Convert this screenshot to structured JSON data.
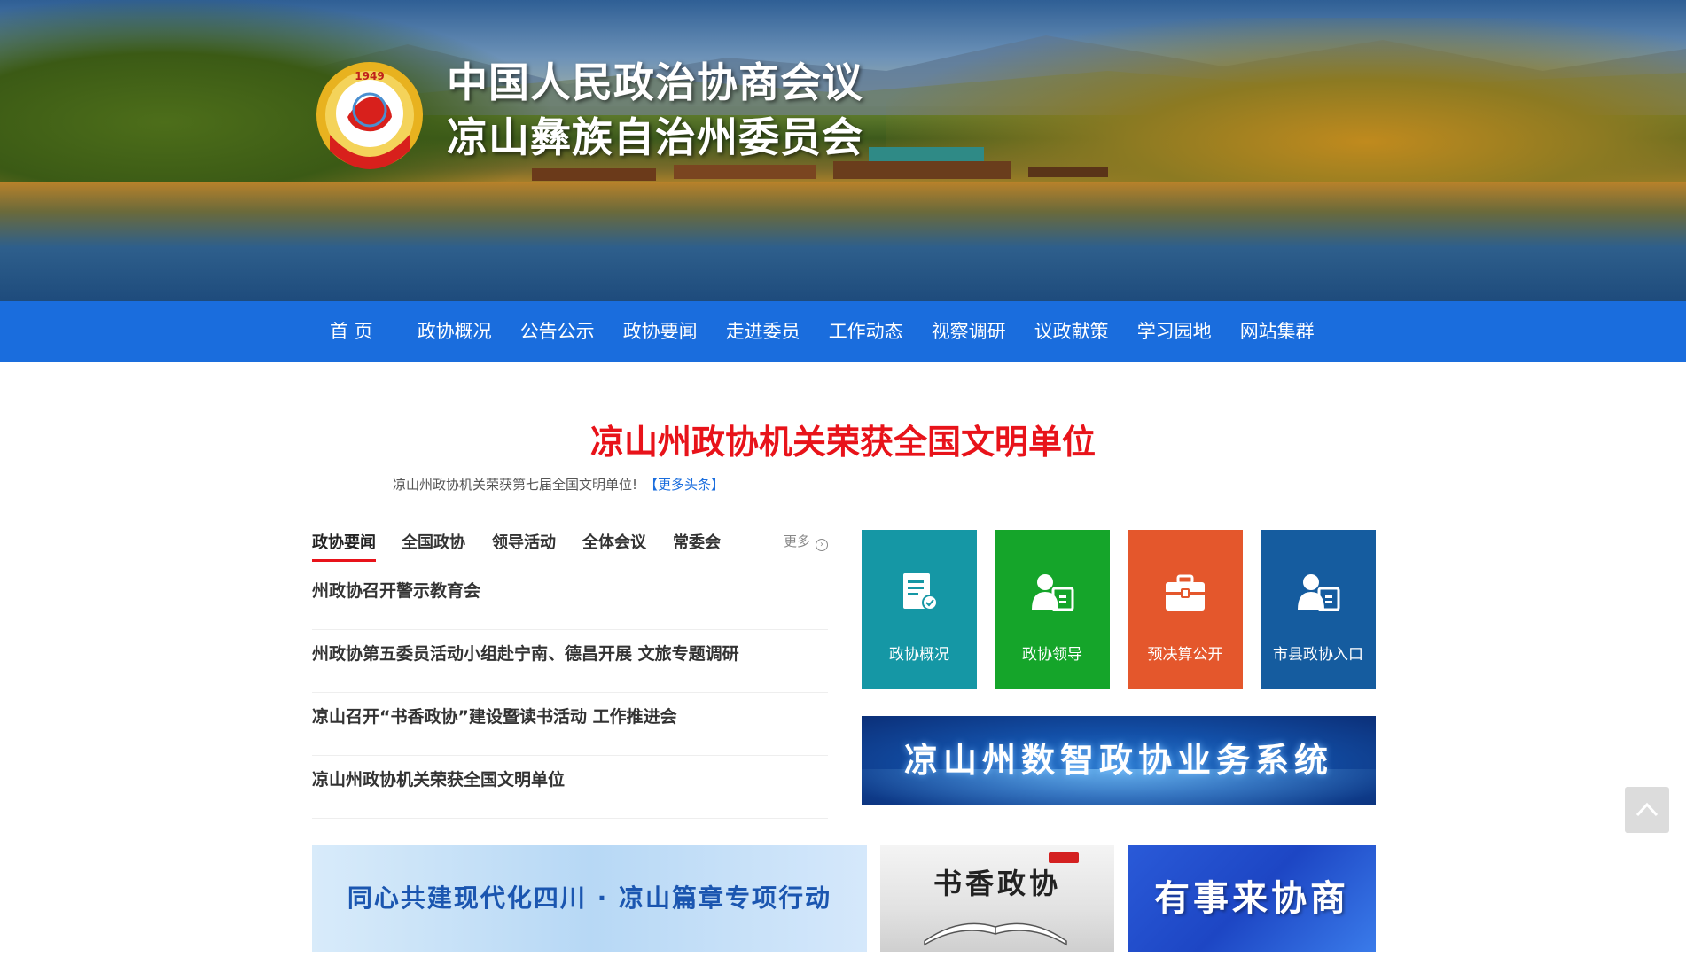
{
  "header": {
    "title_line1": "中国人民政治协商会议",
    "title_line2": "凉山彝族自治州委员会",
    "emblem_year": "1949"
  },
  "nav": {
    "items": [
      "首 页",
      "政协概况",
      "公告公示",
      "政协要闻",
      "走进委员",
      "工作动态",
      "视察调研",
      "议政献策",
      "学习园地",
      "网站集群"
    ]
  },
  "headline": {
    "title": "凉山州政协机关荣获全国文明单位",
    "summary": "凉山州政协机关荣获第七届全国文明单位!",
    "more_label": "【更多头条】"
  },
  "news": {
    "tabs": [
      "政协要闻",
      "全国政协",
      "领导活动",
      "全体会议",
      "常委会"
    ],
    "active_tab": "政协要闻",
    "more_label": "更多",
    "items": [
      "州政协召开警示教育会",
      "州政协第五委员活动小组赴宁南、德昌开展 文旅专题调研",
      "凉山召开“书香政协”建设暨读书活动 工作推进会",
      "凉山州政协机关荣获全国文明单位"
    ]
  },
  "tiles": [
    {
      "label": "政协概况",
      "icon": "document-icon",
      "color": "#1597a5"
    },
    {
      "label": "政协领导",
      "icon": "person-card-icon",
      "color": "#15a52a"
    },
    {
      "label": "预决算公开",
      "icon": "briefcase-icon",
      "color": "#e4572c"
    },
    {
      "label": "市县政协入口",
      "icon": "person-card-icon",
      "color": "#155c9f"
    }
  ],
  "system_banner": {
    "label": "凉山州数智政协业务系统"
  },
  "bottom_banners": {
    "b1": "同心共建现代化四川 · 凉山篇章专项行动",
    "b2": "书香政协",
    "b3": "有事来协商"
  },
  "colors": {
    "nav_bg": "#1a6ddd",
    "headline_red": "#e8131a"
  }
}
